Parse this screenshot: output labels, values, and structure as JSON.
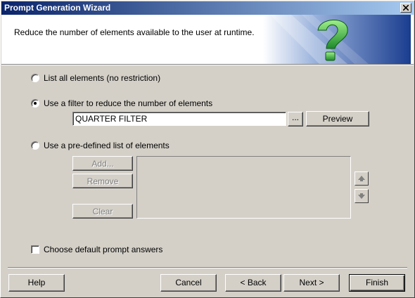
{
  "window": {
    "title": "Prompt Generation Wizard"
  },
  "header": {
    "text": "Reduce the number of elements available to the user at runtime."
  },
  "options": {
    "list_all": {
      "label": "List all elements (no restriction)",
      "selected": false
    },
    "use_filter": {
      "label": "Use a filter to reduce the number of elements",
      "selected": true
    },
    "predefined": {
      "label": "Use a pre-defined list of elements",
      "selected": false
    }
  },
  "filter": {
    "value": "QUARTER FILTER",
    "browse_label": "...",
    "preview_label": "Preview"
  },
  "list_buttons": {
    "add": "Add...",
    "remove": "Remove",
    "clear": "Clear"
  },
  "default_answers": {
    "label": "Choose default prompt answers",
    "checked": false
  },
  "footer": {
    "help": "Help",
    "cancel": "Cancel",
    "back": "< Back",
    "next": "Next >",
    "finish": "Finish"
  },
  "icons": {
    "close": "close-icon",
    "move_up": "arrow-up-icon",
    "move_down": "arrow-down-icon",
    "banner": "question-mark-icon"
  }
}
